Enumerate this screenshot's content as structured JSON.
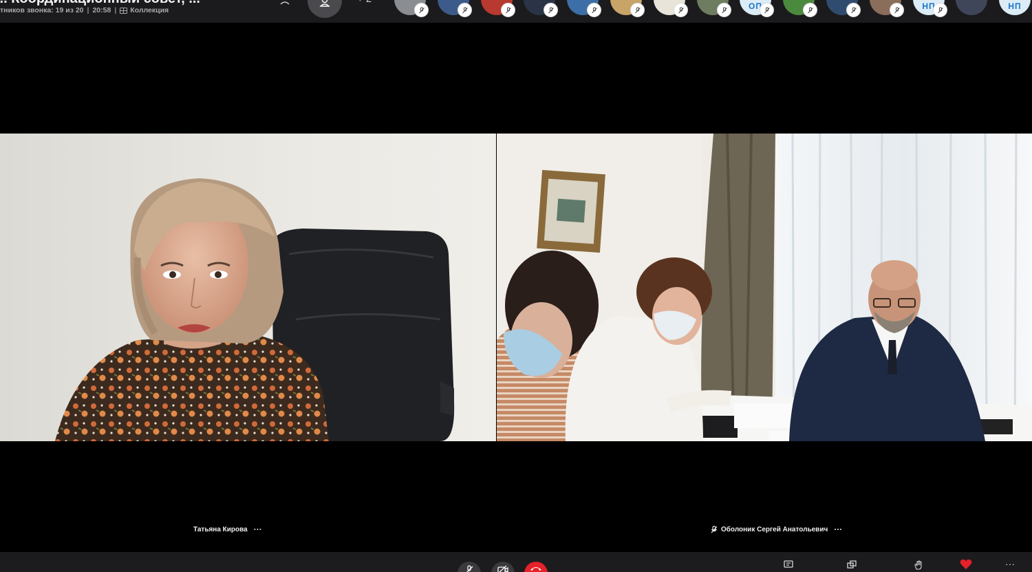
{
  "topbar": {
    "call_title": "... Координационный совет, ...",
    "participants_status": "тников звонка: 19 из 20",
    "separator": "|",
    "duration": "20:58",
    "gallery_label": "Коллекция",
    "extra_participants": "+ 2",
    "avatars": [
      {
        "name": "avatar-participant-1",
        "bg": "#8a8d92"
      },
      {
        "name": "avatar-participant-2",
        "bg": "#3d5b8a"
      },
      {
        "name": "avatar-participant-3",
        "bg": "#b8392f"
      },
      {
        "name": "avatar-participant-4",
        "bg": "#2a3446"
      },
      {
        "name": "avatar-participant-5",
        "bg": "#3c6fa8"
      },
      {
        "name": "avatar-participant-6",
        "bg": "#c9a468"
      },
      {
        "name": "avatar-participant-7",
        "bg": "#e9e4da"
      },
      {
        "name": "avatar-participant-8",
        "bg": "#6e7d5f"
      },
      {
        "name": "avatar-participant-9",
        "bg": "#dcecf7",
        "initials": "ОП"
      },
      {
        "name": "avatar-participant-10",
        "bg": "#4b8a3e"
      },
      {
        "name": "avatar-participant-11",
        "bg": "#2f4c6e"
      },
      {
        "name": "avatar-participant-12",
        "bg": "#8a6d5a"
      },
      {
        "name": "avatar-participant-13",
        "bg": "#dcecf7",
        "initials": "НП"
      },
      {
        "name": "avatar-participant-14",
        "bg": "#40465a"
      },
      {
        "name": "avatar-participant-15",
        "bg": "#dcecf7",
        "initials": "НП"
      }
    ]
  },
  "tiles": {
    "left": {
      "participant_name": "Татьяна Кирова",
      "more": "···"
    },
    "right": {
      "participant_name": "Оболоник Сергей Анатольевич",
      "more": "···",
      "muted": true
    }
  },
  "colors": {
    "background": "#000000",
    "topbar": "#1b1b1d",
    "bottombar": "#1c1c1e",
    "end_call": "#e5212a",
    "heart": "#e5212a"
  },
  "bottombar": {
    "controls": [
      "mic-button",
      "camera-button",
      "end-call-button"
    ],
    "tools": [
      "chat-button",
      "screen-share-button",
      "raise-hand-button",
      "reaction-button",
      "more-options-button"
    ],
    "more_glyph": "···"
  }
}
